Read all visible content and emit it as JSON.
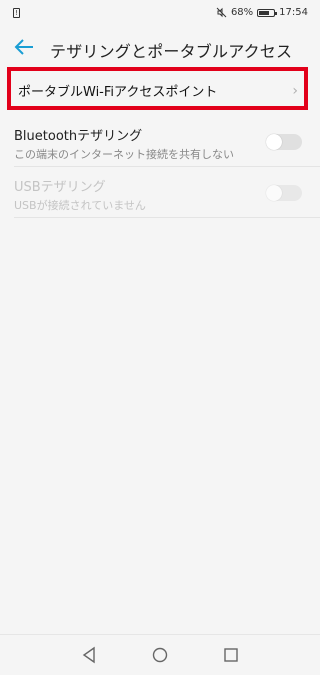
{
  "status_bar": {
    "mute_icon": "mute-icon",
    "battery": "68%",
    "battery_level": 0.68,
    "time": "17:54"
  },
  "header": {
    "title": "テザリングとポータブルアクセス"
  },
  "items": [
    {
      "title": "ポータブルWi-Fiアクセスポイント"
    }
  ],
  "toggles": [
    {
      "title": "Bluetoothテザリング",
      "subtitle": "この端末のインターネット接続を共有しない",
      "enabled": true,
      "checked": false
    },
    {
      "title": "USBテザリング",
      "subtitle": "USBが接続されていません",
      "enabled": false,
      "checked": false
    }
  ],
  "colors": {
    "accent": "#1a9ed4",
    "highlight_border": "#e2001a"
  }
}
